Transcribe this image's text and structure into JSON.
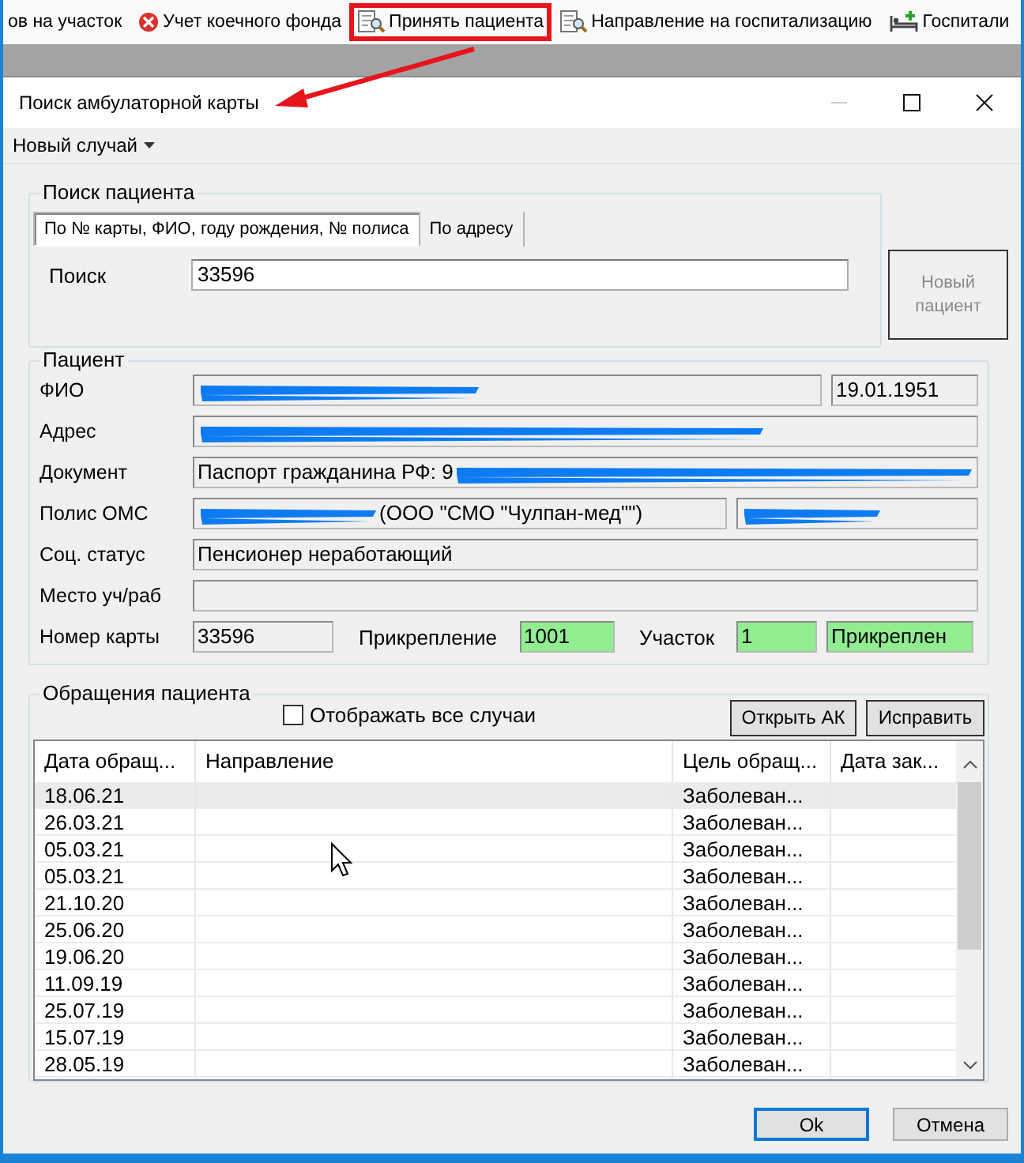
{
  "toolbar": {
    "items": [
      {
        "label": "ов на участок",
        "highlighted": false
      },
      {
        "label": "Учет коечного фонда",
        "highlighted": false
      },
      {
        "label": "Принять пациента",
        "highlighted": true
      },
      {
        "label": "Направление на госпитализацию",
        "highlighted": false
      },
      {
        "label": "Госпитали",
        "highlighted": false
      }
    ]
  },
  "dialog": {
    "title": "Поиск амбулаторной карты",
    "menu": "Новый случай"
  },
  "search": {
    "title": "Поиск пациента",
    "tabs": [
      {
        "label": "По № карты, ФИО, году рождения, № полиса",
        "selected": true
      },
      {
        "label": "По адресу",
        "selected": false
      }
    ],
    "label": "Поиск",
    "value": "33596",
    "new_patient": {
      "label": "Новый пациент",
      "disabled": true
    }
  },
  "patient": {
    "title": "Пациент",
    "rows": [
      {
        "label": "ФИО",
        "items": [
          {
            "kind": "field",
            "highlighted": false,
            "parts": [
              {
                "kind": "redacted"
              }
            ]
          },
          {
            "kind": "field",
            "highlighted": false,
            "parts": [
              {
                "kind": "text",
                "text": "19.01.1951"
              }
            ]
          }
        ]
      },
      {
        "label": "Адрес",
        "items": [
          {
            "kind": "field",
            "highlighted": false,
            "parts": [
              {
                "kind": "redacted"
              }
            ]
          }
        ]
      },
      {
        "label": "Документ",
        "items": [
          {
            "kind": "field",
            "highlighted": false,
            "parts": [
              {
                "kind": "text",
                "text": "Паспорт гражданина РФ: 9"
              },
              {
                "kind": "redacted"
              }
            ]
          }
        ]
      },
      {
        "label": "Полис ОМС",
        "items": [
          {
            "kind": "field",
            "highlighted": false,
            "parts": [
              {
                "kind": "redacted"
              },
              {
                "kind": "text",
                "text": "(ООО \"СМО \"Чулпан-мед\"\")"
              }
            ]
          },
          {
            "kind": "field",
            "highlighted": false,
            "parts": [
              {
                "kind": "redacted"
              }
            ]
          }
        ]
      },
      {
        "label": "Соц. статус",
        "items": [
          {
            "kind": "field",
            "highlighted": false,
            "parts": [
              {
                "kind": "text",
                "text": "Пенсионер неработающий"
              }
            ]
          }
        ]
      },
      {
        "label": "Место уч/раб",
        "items": [
          {
            "kind": "field",
            "highlighted": false
          }
        ]
      },
      {
        "label": "Номер карты",
        "items": [
          {
            "kind": "field",
            "highlighted": false,
            "parts": [
              {
                "kind": "text",
                "text": "33596"
              }
            ]
          },
          {
            "kind": "label",
            "text": "Прикрепление"
          },
          {
            "kind": "field",
            "highlighted": true,
            "parts": [
              {
                "kind": "text",
                "text": "1001"
              }
            ]
          },
          {
            "kind": "label",
            "text": "Участок"
          },
          {
            "kind": "field",
            "highlighted": true,
            "parts": [
              {
                "kind": "text",
                "text": "1"
              }
            ]
          },
          {
            "kind": "field",
            "highlighted": true,
            "parts": [
              {
                "kind": "text",
                "text": "Прикреплен"
              }
            ]
          }
        ]
      }
    ]
  },
  "visits": {
    "title": "Обращения пациента",
    "show_all": {
      "label": "Отображать все случаи",
      "checked": false
    },
    "buttons": [
      "Открыть АК",
      "Исправить"
    ],
    "table": {
      "columns": [
        "Дата обращ...",
        "Направление",
        "Цель обращ...",
        "Дата зак..."
      ],
      "rows": [
        {
          "date": "18.06.21",
          "purpose": "Заболеван...",
          "selected": true
        },
        {
          "date": "26.03.21",
          "purpose": "Заболеван...",
          "selected": false
        },
        {
          "date": "05.03.21",
          "purpose": "Заболеван...",
          "selected": false
        },
        {
          "date": "05.03.21",
          "purpose": "Заболеван...",
          "selected": false
        },
        {
          "date": "21.10.20",
          "purpose": "Заболеван...",
          "selected": false
        },
        {
          "date": "25.06.20",
          "purpose": "Заболеван...",
          "selected": false
        },
        {
          "date": "19.06.20",
          "purpose": "Заболеван...",
          "selected": false
        },
        {
          "date": "11.09.19",
          "purpose": "Заболеван...",
          "selected": false
        },
        {
          "date": "25.07.19",
          "purpose": "Заболеван...",
          "selected": false
        },
        {
          "date": "15.07.19",
          "purpose": "Заболеван...",
          "selected": false
        },
        {
          "date": "28.05.19",
          "purpose": "Заболеван...",
          "selected": false
        }
      ]
    }
  },
  "footer": {
    "buttons": [
      {
        "label": "Ok",
        "default": true
      },
      {
        "label": "Отмена",
        "default": false
      }
    ]
  }
}
